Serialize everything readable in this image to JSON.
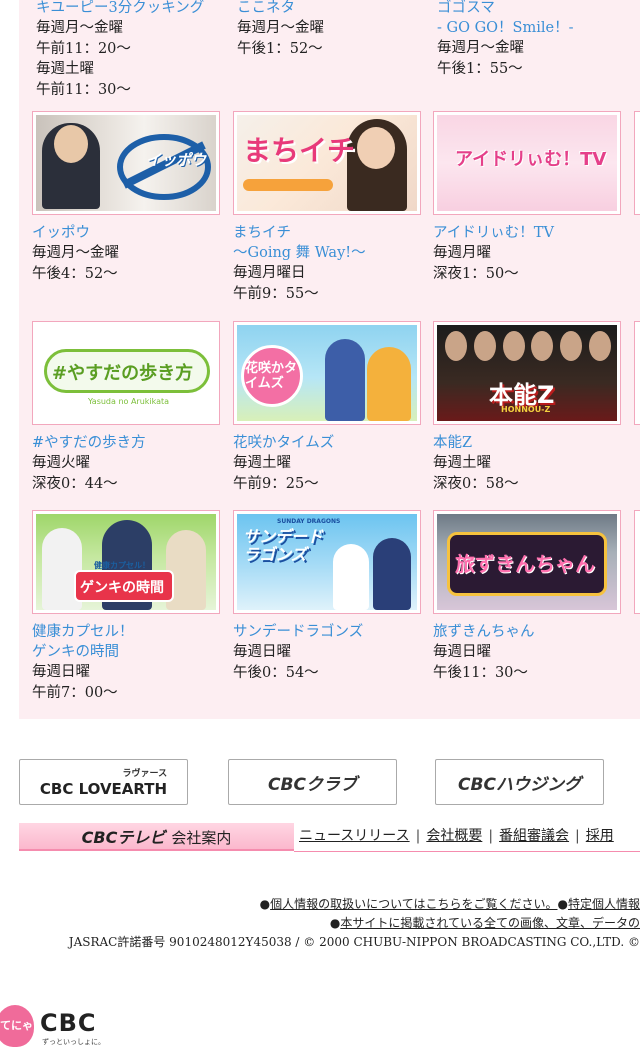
{
  "top_programs": [
    {
      "title": "キユーピー3分クッキング",
      "lines": [
        "毎週月〜金曜",
        "午前11：20〜",
        "毎週土曜",
        "午前11：30〜"
      ]
    },
    {
      "title": "ここネタ",
      "lines": [
        "毎週月〜金曜",
        "午後1：52〜"
      ]
    },
    {
      "title": "ゴゴスマ",
      "subtitle": "- GO GO！Smile！-",
      "lines": [
        "毎週月〜金曜",
        "午後1：55〜"
      ]
    }
  ],
  "programs_row1": [
    {
      "title": "イッポウ",
      "lines": [
        "毎週月〜金曜",
        "午後4：52〜"
      ],
      "logo": "イッポウ"
    },
    {
      "title": "まちイチ",
      "subtitle": "〜Going 舞 Way!〜",
      "lines": [
        "毎週月曜日",
        "午前9：55〜"
      ],
      "logo": "まちイチ"
    },
    {
      "title": "アイドリぃむ！TV",
      "lines": [
        "毎週月曜",
        "深夜1：50〜"
      ],
      "logo": "アイドリぃむ！TV"
    }
  ],
  "programs_row2": [
    {
      "title": "#やすだの歩き方",
      "lines": [
        "毎週火曜",
        "深夜0：44〜"
      ],
      "logo": "#やすだの歩き方",
      "logo_sub": "Yasuda no Arukikata"
    },
    {
      "title": "花咲かタイムズ",
      "lines": [
        "毎週土曜",
        "午前9：25〜"
      ],
      "logo": "花咲かタイムズ"
    },
    {
      "title": "本能Z",
      "lines": [
        "毎週土曜",
        "深夜0：58〜"
      ],
      "logo": "本能Z",
      "logo_sub": "HONNOU-Z"
    }
  ],
  "programs_row3": [
    {
      "title": "健康カプセル！",
      "subtitle": "ゲンキの時間",
      "lines": [
        "毎週日曜",
        "午前7：00〜"
      ],
      "logo": "ゲンキの時間",
      "logo_sub": "健康カプセル！"
    },
    {
      "title": "サンデードラゴンズ",
      "lines": [
        "毎週日曜",
        "午後0：54〜"
      ],
      "logo": "サンデードラゴンズ",
      "logo_sub": "SUNDAY DRAGONS"
    },
    {
      "title": "旅ずきんちゃん",
      "lines": [
        "毎週日曜",
        "午後11：30〜"
      ],
      "logo": "旅ずきんちゃん"
    }
  ],
  "footer_buttons": [
    {
      "label": "CBC LOVEARTH",
      "small": "ラヴァース"
    },
    {
      "label": "CBCクラブ"
    },
    {
      "label": "CBCハウジング"
    }
  ],
  "company": {
    "bar_brand": "CBCテレビ",
    "bar_label": "会社案内",
    "links": [
      "ニュースリリース",
      "会社概要",
      "番組審議会",
      "採用"
    ]
  },
  "legal": {
    "line1_link1": "個人情報の取扱いについてはこちらをご覧ください。",
    "line1_link2": "特定個人情報",
    "line2_link": "本サイトに掲載されている全ての画像、文章、データの",
    "line3": "JASRAC許諾番号 9010248012Y45038 / © 2000 CHUBU-NIPPON BROADCASTING CO.,LTD. ©"
  },
  "brand": {
    "logo_text": "CBC",
    "tagline": "ずっといっしょに。",
    "mascot_text": "てにゃ"
  },
  "colors": {
    "panel_bg": "#fdeef2",
    "link_blue": "#3a8fd6",
    "thumb_border": "#f2a7bd",
    "bar_pink": "#fbb8cd"
  }
}
